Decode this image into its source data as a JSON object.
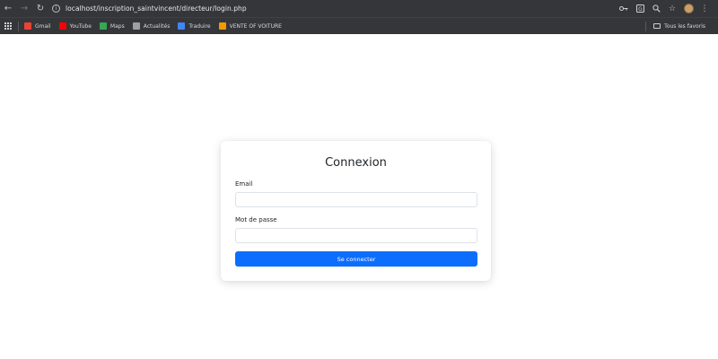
{
  "browser": {
    "url": "localhost/inscription_saintvincent/directeur/login.php",
    "bookmarks": [
      {
        "label": "Gmail",
        "color": "#ea4335"
      },
      {
        "label": "YouTube",
        "color": "#ff0000"
      },
      {
        "label": "Maps",
        "color": "#34a853"
      },
      {
        "label": "Actualités",
        "color": "#9aa0a6"
      },
      {
        "label": "Traduire",
        "color": "#4285f4"
      },
      {
        "label": "VENTE OF VOITURE",
        "color": "#f29900"
      }
    ],
    "all_bookmarks_label": "Tous les favoris"
  },
  "login": {
    "title": "Connexion",
    "email_label": "Email",
    "email_value": "",
    "password_label": "Mot de passe",
    "password_value": "",
    "submit_label": "Se connecter"
  },
  "colors": {
    "primary": "#0d6efd",
    "chrome": "#35363a"
  }
}
